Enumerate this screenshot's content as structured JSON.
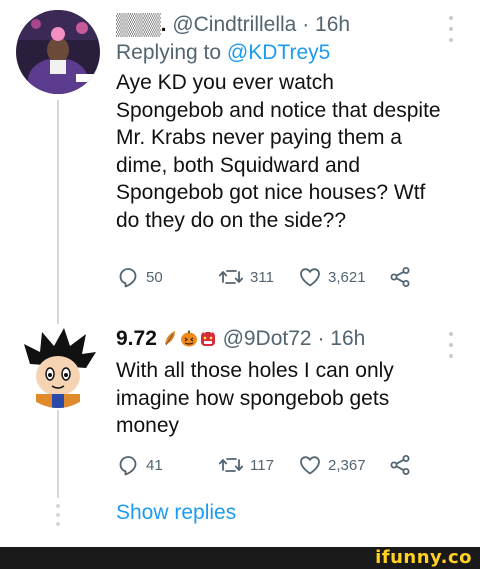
{
  "tweets": [
    {
      "display_name": "▒▒▒.",
      "handle": "@Cindtrillella",
      "separator": "·",
      "time": "16h",
      "replying_prefix": "Replying to",
      "replying_to": "@KDTrey5",
      "text": "Aye KD you ever watch Spongebob and notice that despite Mr. Krabs never paying them a dime, both Squidward and Spongebob got nice houses? Wtf do they do on the side??",
      "replies": "50",
      "retweets": "311",
      "likes": "3,621"
    },
    {
      "display_name": "9.72",
      "handle": "@9Dot72",
      "separator": "·",
      "time": "16h",
      "text": "With all those holes I can only imagine how spongebob gets money",
      "replies": "41",
      "retweets": "117",
      "likes": "2,367"
    }
  ],
  "show_replies": "Show replies",
  "watermark": "ifunny.co",
  "colors": {
    "link": "#1d9bf0",
    "secondary_text": "#536471",
    "footer_bg": "#1a1a1a",
    "watermark": "#ffd21f"
  },
  "icons": [
    "reply-icon",
    "retweet-icon",
    "like-icon",
    "share-icon",
    "more-icon"
  ]
}
